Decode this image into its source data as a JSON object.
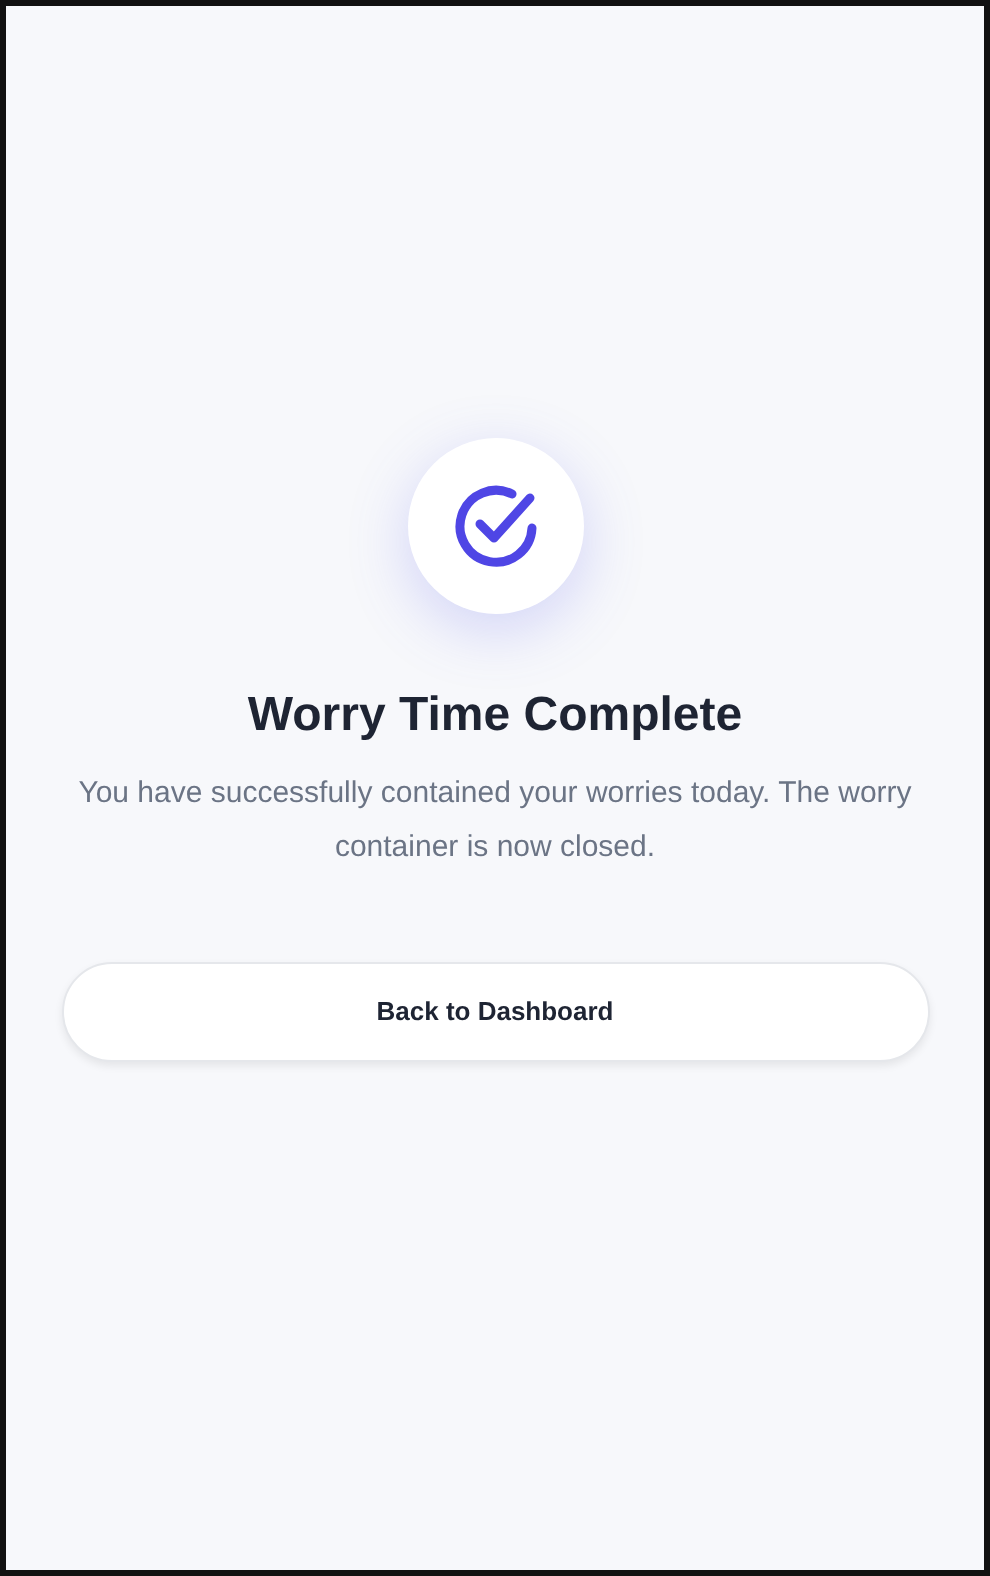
{
  "title": "Worry Time Complete",
  "message": "You have successfully contained your worries today. The worry container is now closed.",
  "buttons": [
    {
      "label": "Back to Dashboard"
    }
  ]
}
